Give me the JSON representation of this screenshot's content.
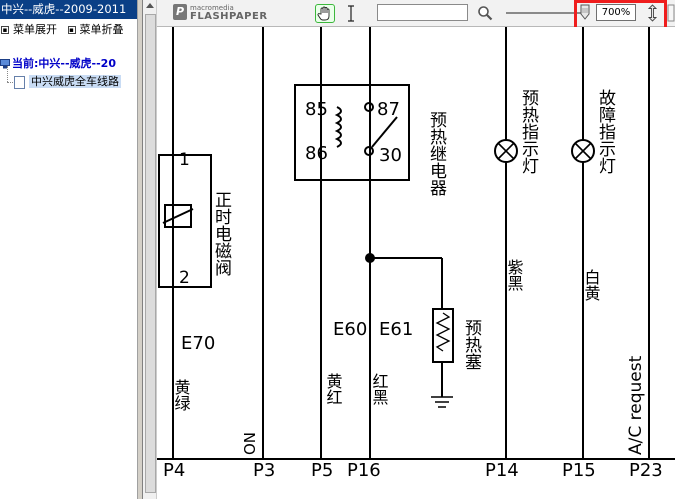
{
  "sidebar": {
    "title": "中兴--威虎--2009-2011",
    "expand_label": "菜单展开",
    "collapse_label": "菜单折叠",
    "tree": {
      "root_label": "当前:中兴--威虎--20",
      "child_label": "中兴威虎全车线路"
    }
  },
  "toolbar": {
    "logo_small": "macromedia",
    "logo_big": "FLASHPAPER",
    "search_value": "",
    "zoom_value": "700%",
    "icons": [
      "hand-tool-icon",
      "text-select-icon",
      "search-icon",
      "zoom-slider-icon",
      "fit-page-icon"
    ]
  },
  "schematic": {
    "relay_pins": {
      "p85": "85",
      "p86": "86",
      "p87": "87",
      "p30": "30"
    },
    "ports": {
      "p4": "P4",
      "p3": "P3",
      "p5": "P5",
      "p16": "P16",
      "p14": "P14",
      "p15": "P15",
      "p23": "P23"
    },
    "labels": {
      "coil_pin1": "1",
      "coil_pin2": "2",
      "e70": "E70",
      "e60": "E60",
      "e61": "E61",
      "ac_request": "A/C request",
      "on": "ON",
      "solenoid_valve": "正时电磁阀",
      "preheat_relay": "预热继电器",
      "preheat_plug": "预热塞",
      "preheat_lamp": "预热指示灯",
      "fault_lamp": "故障指示灯",
      "wire_yellow_green": "黄绿",
      "wire_yellow_red": "黄红",
      "wire_red_black": "红黑",
      "wire_purple_black": "紫黑",
      "wire_white_yellow": "白黄"
    }
  },
  "colors": {
    "title_bar": "#0a3f86",
    "tree_root_text": "#0000c8",
    "highlight_box": "#ef1d1d",
    "hand_tool_border": "#3bb73b"
  }
}
